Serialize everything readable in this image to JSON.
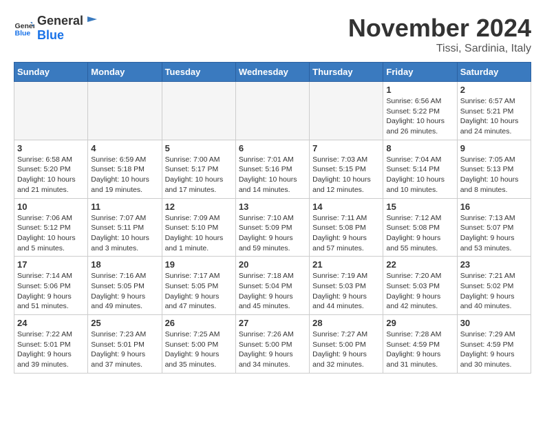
{
  "header": {
    "logo_general": "General",
    "logo_blue": "Blue",
    "month": "November 2024",
    "location": "Tissi, Sardinia, Italy"
  },
  "weekdays": [
    "Sunday",
    "Monday",
    "Tuesday",
    "Wednesday",
    "Thursday",
    "Friday",
    "Saturday"
  ],
  "weeks": [
    [
      {
        "day": "",
        "empty": true
      },
      {
        "day": "",
        "empty": true
      },
      {
        "day": "",
        "empty": true
      },
      {
        "day": "",
        "empty": true
      },
      {
        "day": "",
        "empty": true
      },
      {
        "day": "1",
        "info": "Sunrise: 6:56 AM\nSunset: 5:22 PM\nDaylight: 10 hours\nand 26 minutes."
      },
      {
        "day": "2",
        "info": "Sunrise: 6:57 AM\nSunset: 5:21 PM\nDaylight: 10 hours\nand 24 minutes."
      }
    ],
    [
      {
        "day": "3",
        "info": "Sunrise: 6:58 AM\nSunset: 5:20 PM\nDaylight: 10 hours\nand 21 minutes."
      },
      {
        "day": "4",
        "info": "Sunrise: 6:59 AM\nSunset: 5:18 PM\nDaylight: 10 hours\nand 19 minutes."
      },
      {
        "day": "5",
        "info": "Sunrise: 7:00 AM\nSunset: 5:17 PM\nDaylight: 10 hours\nand 17 minutes."
      },
      {
        "day": "6",
        "info": "Sunrise: 7:01 AM\nSunset: 5:16 PM\nDaylight: 10 hours\nand 14 minutes."
      },
      {
        "day": "7",
        "info": "Sunrise: 7:03 AM\nSunset: 5:15 PM\nDaylight: 10 hours\nand 12 minutes."
      },
      {
        "day": "8",
        "info": "Sunrise: 7:04 AM\nSunset: 5:14 PM\nDaylight: 10 hours\nand 10 minutes."
      },
      {
        "day": "9",
        "info": "Sunrise: 7:05 AM\nSunset: 5:13 PM\nDaylight: 10 hours\nand 8 minutes."
      }
    ],
    [
      {
        "day": "10",
        "info": "Sunrise: 7:06 AM\nSunset: 5:12 PM\nDaylight: 10 hours\nand 5 minutes."
      },
      {
        "day": "11",
        "info": "Sunrise: 7:07 AM\nSunset: 5:11 PM\nDaylight: 10 hours\nand 3 minutes."
      },
      {
        "day": "12",
        "info": "Sunrise: 7:09 AM\nSunset: 5:10 PM\nDaylight: 10 hours\nand 1 minute."
      },
      {
        "day": "13",
        "info": "Sunrise: 7:10 AM\nSunset: 5:09 PM\nDaylight: 9 hours\nand 59 minutes."
      },
      {
        "day": "14",
        "info": "Sunrise: 7:11 AM\nSunset: 5:08 PM\nDaylight: 9 hours\nand 57 minutes."
      },
      {
        "day": "15",
        "info": "Sunrise: 7:12 AM\nSunset: 5:08 PM\nDaylight: 9 hours\nand 55 minutes."
      },
      {
        "day": "16",
        "info": "Sunrise: 7:13 AM\nSunset: 5:07 PM\nDaylight: 9 hours\nand 53 minutes."
      }
    ],
    [
      {
        "day": "17",
        "info": "Sunrise: 7:14 AM\nSunset: 5:06 PM\nDaylight: 9 hours\nand 51 minutes."
      },
      {
        "day": "18",
        "info": "Sunrise: 7:16 AM\nSunset: 5:05 PM\nDaylight: 9 hours\nand 49 minutes."
      },
      {
        "day": "19",
        "info": "Sunrise: 7:17 AM\nSunset: 5:05 PM\nDaylight: 9 hours\nand 47 minutes."
      },
      {
        "day": "20",
        "info": "Sunrise: 7:18 AM\nSunset: 5:04 PM\nDaylight: 9 hours\nand 45 minutes."
      },
      {
        "day": "21",
        "info": "Sunrise: 7:19 AM\nSunset: 5:03 PM\nDaylight: 9 hours\nand 44 minutes."
      },
      {
        "day": "22",
        "info": "Sunrise: 7:20 AM\nSunset: 5:03 PM\nDaylight: 9 hours\nand 42 minutes."
      },
      {
        "day": "23",
        "info": "Sunrise: 7:21 AM\nSunset: 5:02 PM\nDaylight: 9 hours\nand 40 minutes."
      }
    ],
    [
      {
        "day": "24",
        "info": "Sunrise: 7:22 AM\nSunset: 5:01 PM\nDaylight: 9 hours\nand 39 minutes."
      },
      {
        "day": "25",
        "info": "Sunrise: 7:23 AM\nSunset: 5:01 PM\nDaylight: 9 hours\nand 37 minutes."
      },
      {
        "day": "26",
        "info": "Sunrise: 7:25 AM\nSunset: 5:00 PM\nDaylight: 9 hours\nand 35 minutes."
      },
      {
        "day": "27",
        "info": "Sunrise: 7:26 AM\nSunset: 5:00 PM\nDaylight: 9 hours\nand 34 minutes."
      },
      {
        "day": "28",
        "info": "Sunrise: 7:27 AM\nSunset: 5:00 PM\nDaylight: 9 hours\nand 32 minutes."
      },
      {
        "day": "29",
        "info": "Sunrise: 7:28 AM\nSunset: 4:59 PM\nDaylight: 9 hours\nand 31 minutes."
      },
      {
        "day": "30",
        "info": "Sunrise: 7:29 AM\nSunset: 4:59 PM\nDaylight: 9 hours\nand 30 minutes."
      }
    ]
  ]
}
